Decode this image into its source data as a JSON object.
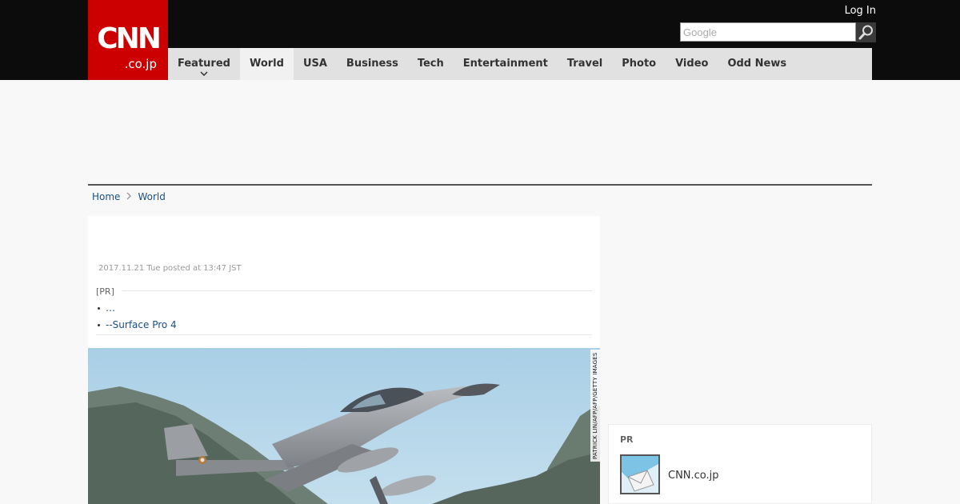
{
  "header": {
    "logo_top": "CNN",
    "logo_bottom": ".co.jp",
    "login_label": "Log In",
    "search_placeholder": "Google"
  },
  "nav": {
    "items": [
      {
        "label": "Featured"
      },
      {
        "label": "World"
      },
      {
        "label": "USA"
      },
      {
        "label": "Business"
      },
      {
        "label": "Tech"
      },
      {
        "label": "Entertainment"
      },
      {
        "label": "Travel"
      },
      {
        "label": "Photo"
      },
      {
        "label": "Video"
      },
      {
        "label": "Odd News"
      }
    ],
    "active_index": 1
  },
  "breadcrumb": {
    "home": "Home",
    "current": "World"
  },
  "article": {
    "posted": "2017.11.21 Tue posted at 13:47 JST",
    "pr_label": "[PR]",
    "pr_links": [
      "…",
      "--Surface Pro 4"
    ],
    "photo_credit": "PATRICK LIN/AFP/AFP/GETTY IMAGES"
  },
  "sidebar": {
    "pr_label": "PR",
    "pr_item_title": "CNN.co.jp"
  },
  "colors": {
    "brand_red": "#cc0000",
    "header_black": "#0c0c0c",
    "nav_gray": "#e1e1e1",
    "link_blue": "#1a4f84"
  },
  "icons": {
    "search": "magnifier-icon",
    "chevron": "chevron-down-icon",
    "breadcrumb_sep": "chevron-right-icon"
  }
}
